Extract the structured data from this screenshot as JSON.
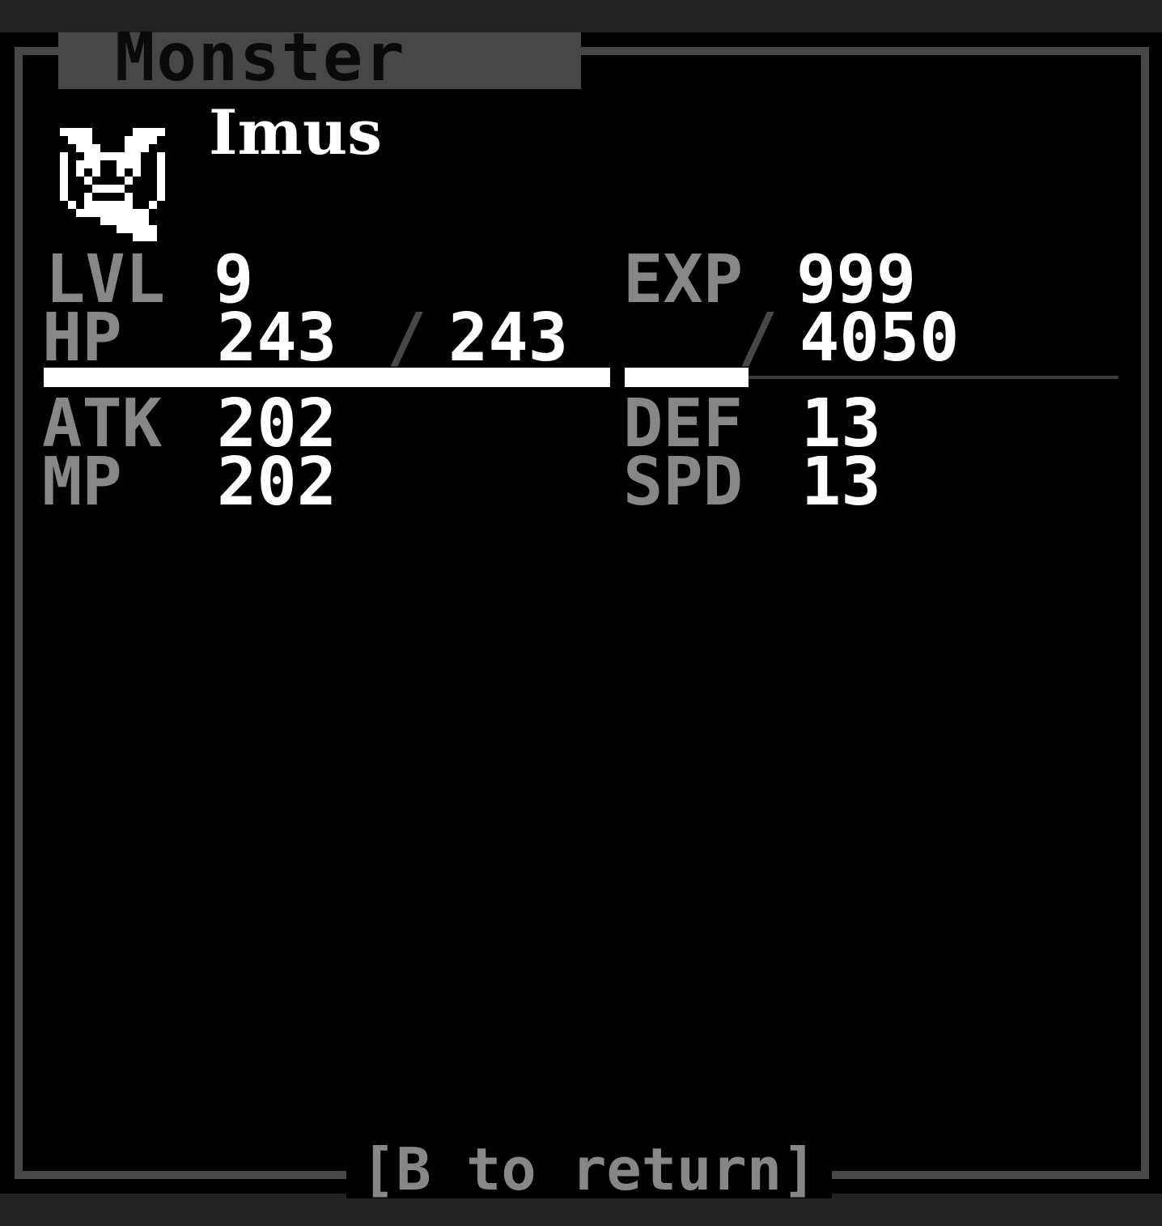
{
  "window": {
    "title": "Monster",
    "footer": "[B to return]"
  },
  "monster": {
    "name": "Imus",
    "icon": "ghost-monster-icon"
  },
  "stats": {
    "lvl_label": "LVL",
    "lvl_value": "9",
    "exp_label": "EXP",
    "exp_value": "999",
    "hp_label": "HP",
    "hp_current": "243",
    "hp_max": "243",
    "exp_next": "4050",
    "atk_label": "ATK",
    "atk_value": "202",
    "def_label": "DEF",
    "def_value": "13",
    "mp_label": "MP",
    "mp_value": "202",
    "spd_label": "SPD",
    "spd_value": "13"
  },
  "bars": {
    "hp_fraction": 1.0,
    "exp_fraction": 0.25
  },
  "colors": {
    "label": "#878787",
    "value": "#ffffff",
    "frame": "#474747",
    "background": "#000000"
  }
}
